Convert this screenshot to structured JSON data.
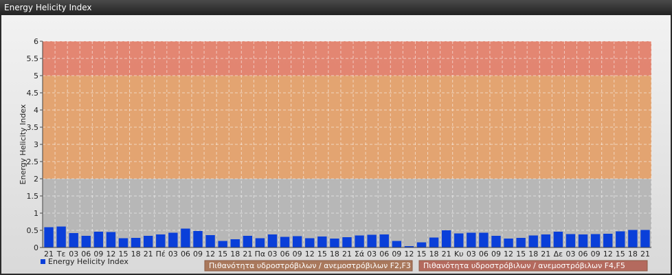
{
  "window": {
    "title": "Energy Helicity Index"
  },
  "chart_data": {
    "type": "bar",
    "ylabel": "Energy Helicity Index",
    "ylim": [
      0,
      6
    ],
    "yticks": [
      0,
      0.5,
      1,
      1.5,
      2,
      2.5,
      3,
      3.5,
      4,
      4.5,
      5,
      5.5,
      6
    ],
    "grid": true,
    "bands": [
      {
        "from": 0,
        "to": 2,
        "color": "#b4b4b4"
      },
      {
        "from": 2,
        "to": 5,
        "color": "#e3a06a"
      },
      {
        "from": 5,
        "to": 6,
        "color": "#e2806a"
      }
    ],
    "categories": [
      "21",
      "Τε",
      "03",
      "06",
      "09",
      "12",
      "15",
      "18",
      "21",
      "Πέ",
      "03",
      "06",
      "09",
      "12",
      "15",
      "18",
      "21",
      "Πα",
      "03",
      "06",
      "09",
      "12",
      "15",
      "18",
      "21",
      "Σά",
      "03",
      "06",
      "09",
      "12",
      "15",
      "18",
      "21",
      "Κυ",
      "03",
      "06",
      "09",
      "12",
      "15",
      "18",
      "21",
      "Δε",
      "03",
      "06",
      "09",
      "12",
      "15",
      "18",
      "21"
    ],
    "series": [
      {
        "name": "Energy Helicity Index",
        "color": "#0a3fd9",
        "values": [
          0.59,
          0.61,
          0.42,
          0.34,
          0.46,
          0.45,
          0.27,
          0.28,
          0.34,
          0.38,
          0.43,
          0.55,
          0.48,
          0.36,
          0.19,
          0.24,
          0.34,
          0.27,
          0.38,
          0.31,
          0.33,
          0.27,
          0.32,
          0.26,
          0.3,
          0.35,
          0.37,
          0.38,
          0.19,
          0.04,
          0.15,
          0.29,
          0.5,
          0.41,
          0.43,
          0.43,
          0.34,
          0.26,
          0.28,
          0.35,
          0.38,
          0.46,
          0.39,
          0.38,
          0.39,
          0.4,
          0.47,
          0.51,
          0.51
        ]
      }
    ],
    "legend": {
      "placement": "bottom-left",
      "label": "Energy Helicity Index"
    },
    "band_labels": [
      {
        "text": "Πιθανότητα υδροστρόβιλων / ανεμοστρόβιλων F2,F3",
        "color": "#a9785c"
      },
      {
        "text": "Πιθανότητα υδροστρόβιλων / ανεμοστρόβιλων F4,F5",
        "color": "#b46a5e"
      }
    ]
  }
}
